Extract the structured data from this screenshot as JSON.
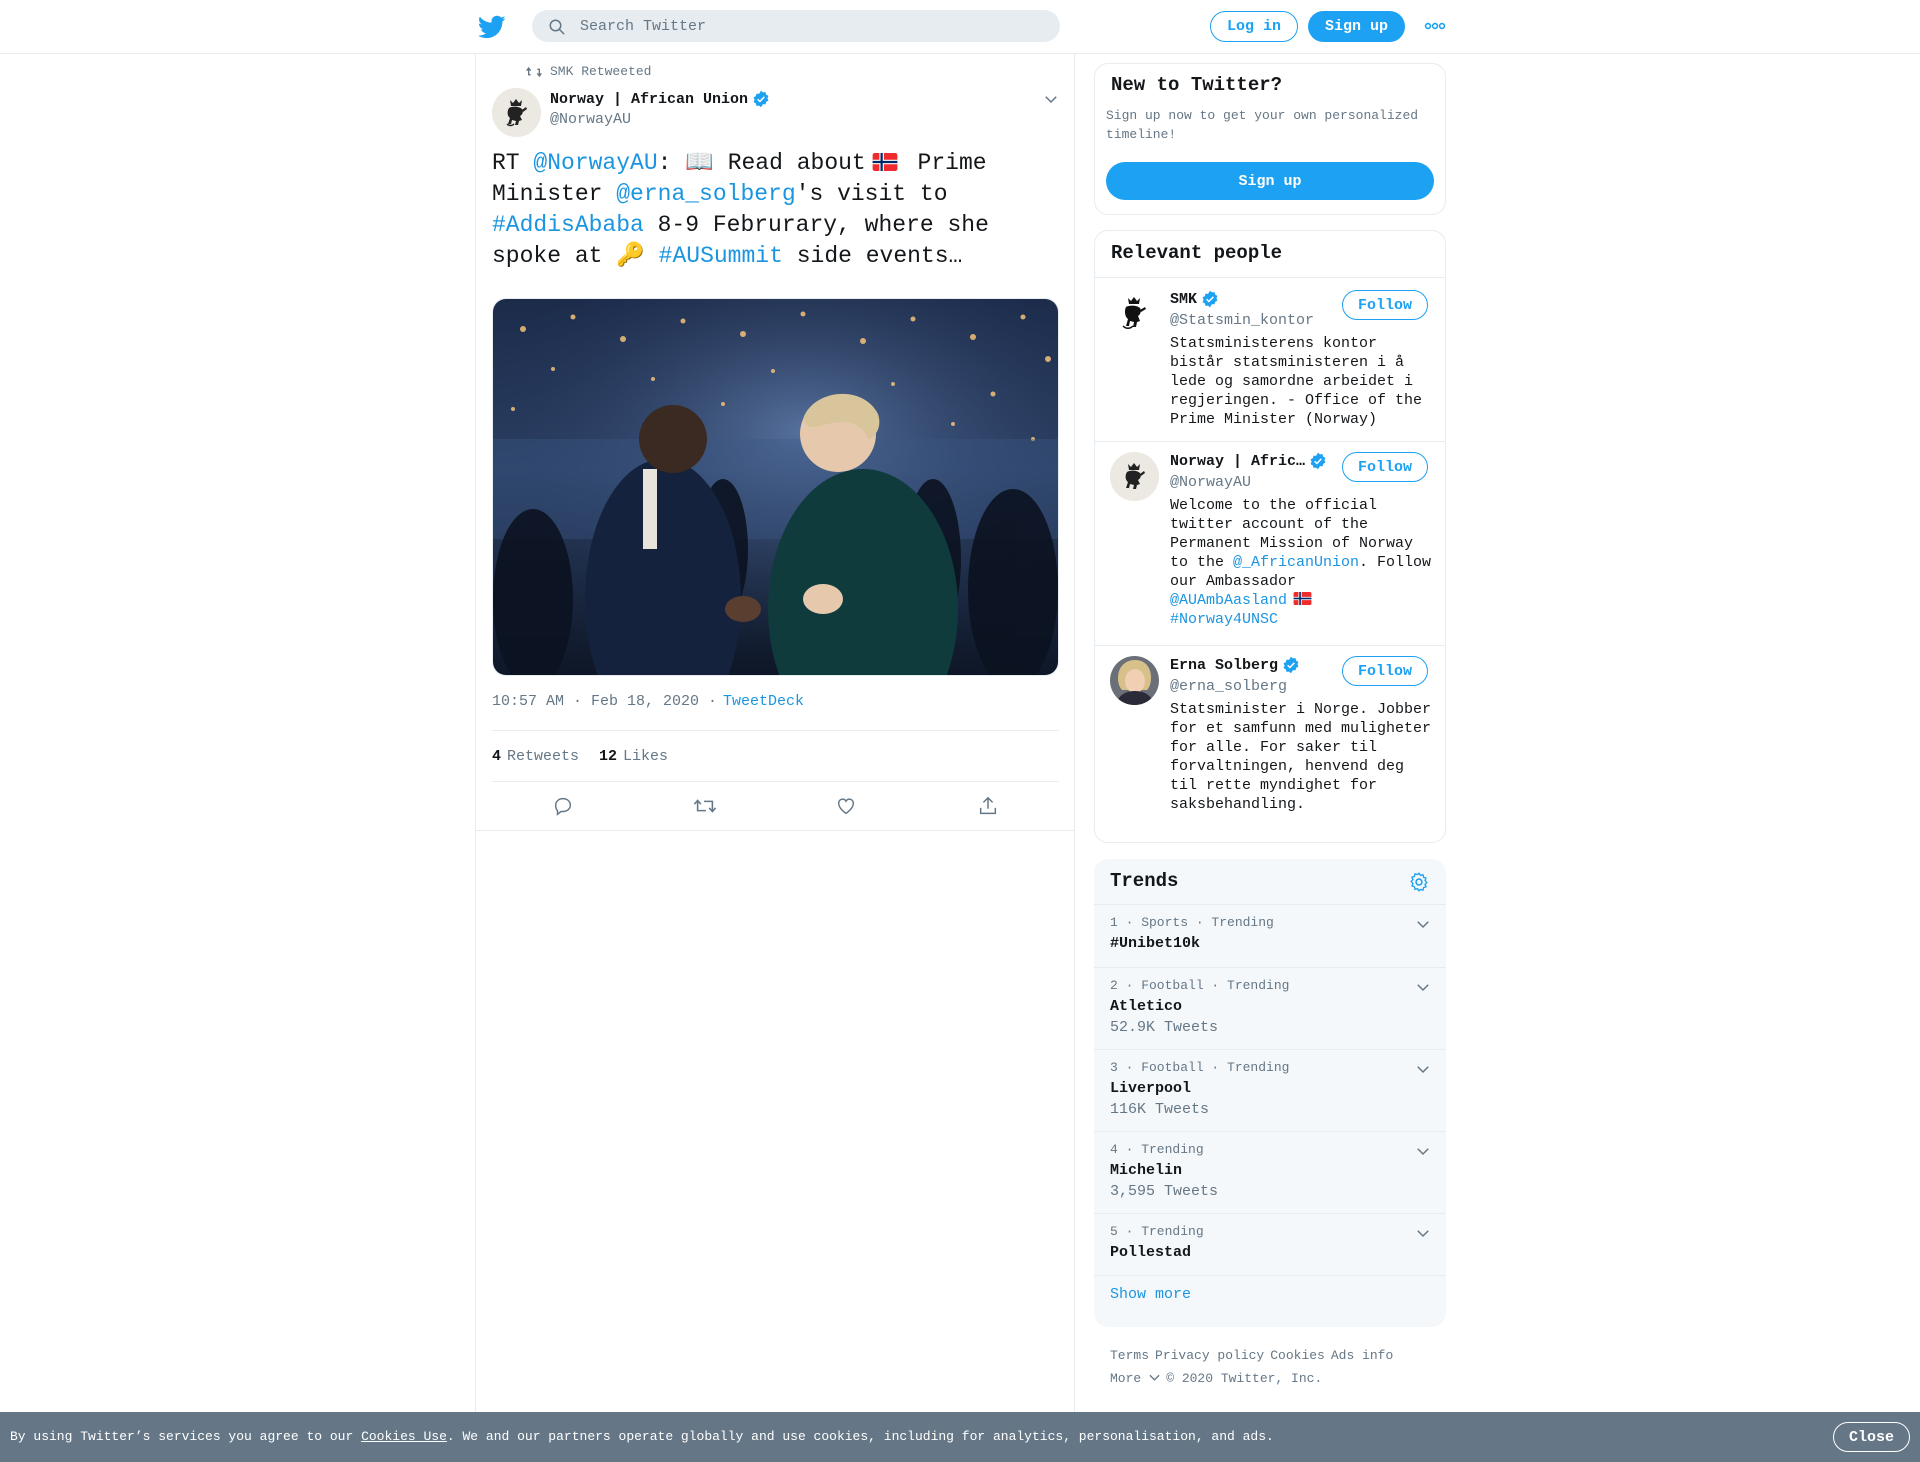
{
  "header": {
    "logo_icon": "twitter-bird-icon",
    "search_placeholder": "Search Twitter",
    "login_label": "Log in",
    "signup_label": "Sign up",
    "more_icon": "more-dots-icon",
    "brand_color": "#1da1f2"
  },
  "tweet": {
    "retweet_context": "SMK Retweeted",
    "author_name": "Norway | African Union",
    "author_handle": "@NorwayAU",
    "text_parts": {
      "rt": "RT ",
      "mention1": "@NorwayAU",
      "after_mention1": ": 📖 Read about",
      "after_flag1": " Prime Minister ",
      "mention2": "@erna_solberg",
      "after_mention2": "'s visit to ",
      "hashtag1": "#AddisAbaba",
      "after_hashtag1": " 8-9 Februrary, where she spoke at 🔑 ",
      "hashtag2": "#AUSummit",
      "after_hashtag2": " side events…"
    },
    "time": "10:57 AM · Feb 18, 2020 ·",
    "source": "TweetDeck",
    "retweets_count": "4",
    "retweets_label": "Retweets",
    "likes_count": "12",
    "likes_label": "Likes",
    "actions": [
      "reply-icon",
      "retweet-icon",
      "like-icon",
      "share-icon"
    ]
  },
  "new_to_twitter": {
    "title": "New to Twitter?",
    "description": "Sign up now to get your own personalized timeline!",
    "button": "Sign up"
  },
  "relevant_people": {
    "title": "Relevant people",
    "follow_label": "Follow",
    "people": [
      {
        "name": "SMK",
        "handle": "@Statsmin_kontor",
        "bio": "Statsministerens kontor bistår statsministeren i å lede og samordne arbeidet i regjeringen. - Office of the Prime Minister (Norway)"
      },
      {
        "name": "Norway | Afric…",
        "handle": "@NorwayAU",
        "bio_start": "Welcome to the official twitter account of the Permanent Mission of Norway to the ",
        "bio_link1": "@_AfricanUnion",
        "bio_mid": ". Follow our Ambassador ",
        "bio_link2": "@AUAmbAasland",
        "bio_link3": "#Norway4UNSC"
      },
      {
        "name": "Erna Solberg",
        "handle": "@erna_solberg",
        "bio": "Statsminister i Norge. Jobber for et samfunn med muligheter for alle. For saker til forvaltningen, henvend deg til rette myndighet for saksbehandling."
      }
    ]
  },
  "trends": {
    "title": "Trends",
    "items": [
      {
        "meta": "1 · Sports · Trending",
        "name": "#Unibet10k",
        "count": ""
      },
      {
        "meta": "2 · Football · Trending",
        "name": "Atletico",
        "count": "52.9K Tweets"
      },
      {
        "meta": "3 · Football · Trending",
        "name": "Liverpool",
        "count": "116K Tweets"
      },
      {
        "meta": "4 · Trending",
        "name": "Michelin",
        "count": "3,595 Tweets"
      },
      {
        "meta": "5 · Trending",
        "name": "Pollestad",
        "count": ""
      }
    ],
    "show_more": "Show more"
  },
  "footer": {
    "links": [
      "Terms",
      "Privacy policy",
      "Cookies",
      "Ads info"
    ],
    "more": "More",
    "copyright": "© 2020 Twitter, Inc."
  },
  "cookie_bar": {
    "text_before": "By using Twitter’s services you agree to our ",
    "link": "Cookies Use",
    "text_after": ". We and our partners operate globally and use cookies, including for analytics, personalisation, and ads.",
    "close": "Close"
  }
}
